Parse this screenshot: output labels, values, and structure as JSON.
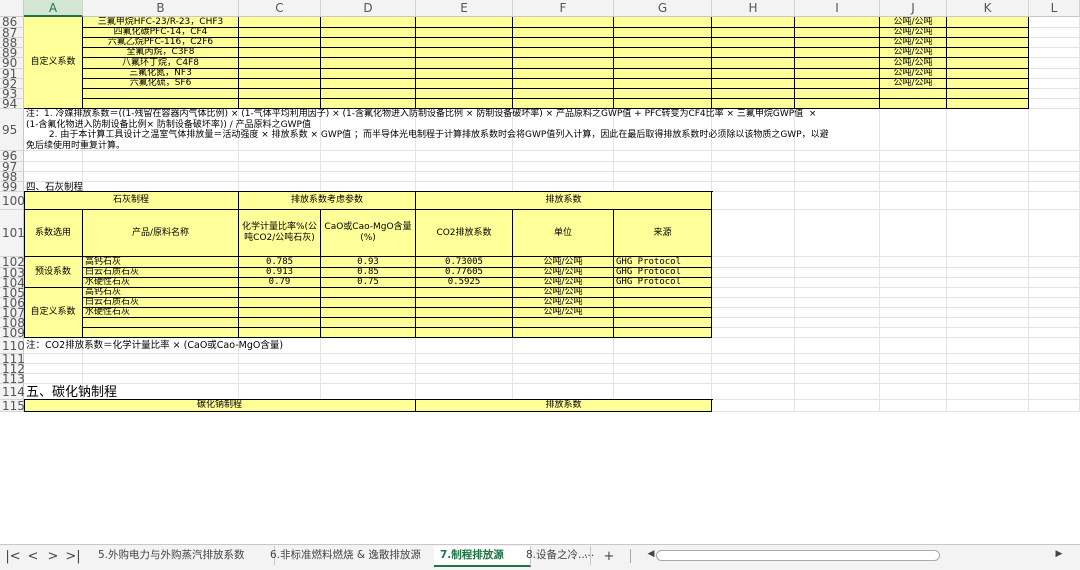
{
  "columns": [
    "A",
    "B",
    "C",
    "D",
    "E",
    "F",
    "G",
    "H",
    "I",
    "J",
    "K",
    "L"
  ],
  "selected_column": "A",
  "rows": [
    "86",
    "87",
    "88",
    "89",
    "90",
    "91",
    "92",
    "93",
    "94",
    "95",
    "96",
    "97",
    "98",
    "99",
    "100",
    "101",
    "102",
    "103",
    "104",
    "105",
    "106",
    "107",
    "108",
    "109",
    "110",
    "111",
    "112",
    "113",
    "114",
    "115"
  ],
  "block1": {
    "label": "自定义系数",
    "gases": [
      "三氟甲烷HFC-23/R-23，CHF3",
      "四氟化碳PFC-14，CF4",
      "六氟乙烷PFC-116，C2F6",
      "全氟丙烷，C3F8",
      "八氟环丁烷，C4F8",
      "三氟化氮，NF3",
      "六氟化硫，SF6"
    ],
    "unit": "公吨/公吨"
  },
  "note95": {
    "line1": "注：1. 冷媒排放系数＝((1-残留在容器内气体比例) × (1-气体平均利用因子) × (1-含氟化物进入防制设备比例 × 防制设备破坏率) × 产品原料之GWP值 + PFC转变为CF4比率 × 三氟甲烷GWP值  ×",
    "line2": "(1-含氟化物进入防制设备比例× 防制设备破坏率)) / 产品原料之GWP值",
    "line3": "        2. 由于本计算工具设计之温室气体排放量＝活动强度 × 排放系数 × GWP值 ；而半导体光电制程于计算排放系数时会将GWP值列入计算，因此在最后取得排放系数时必须除以该物质之GWP，以避",
    "line4": "免后续使用时重复计算。"
  },
  "section4": {
    "heading": "四、石灰制程",
    "hdr_lime": "石灰制程",
    "hdr_params": "排放系数考虑参数",
    "hdr_factor": "排放系数",
    "col_select": "系数选用",
    "col_name": "产品/原料名称",
    "col_ratio": "化学计量比率%(公吨CO2/公吨石灰)",
    "col_cao": "CaO或Cao-MgO含量(%)",
    "col_co2": "CO2排放系数",
    "col_unit": "单位",
    "col_source": "来源",
    "preset_label": "预设系数",
    "custom_label": "自定义系数",
    "preset_rows": [
      {
        "name": "高钙石灰",
        "ratio": "0.785",
        "cao": "0.93",
        "co2": "0.73005",
        "unit": "公吨/公吨",
        "source": "GHG Protocol"
      },
      {
        "name": "白云石质石灰",
        "ratio": "0.913",
        "cao": "0.85",
        "co2": "0.77605",
        "unit": "公吨/公吨",
        "source": "GHG Protocol"
      },
      {
        "name": "水硬性石灰",
        "ratio": "0.79",
        "cao": "0.75",
        "co2": "0.5925",
        "unit": "公吨/公吨",
        "source": "GHG Protocol"
      }
    ],
    "custom_rows": [
      {
        "name": "高钙石灰",
        "unit": "公吨/公吨"
      },
      {
        "name": "白云石质石灰",
        "unit": "公吨/公吨"
      },
      {
        "name": "水硬性石灰",
        "unit": "公吨/公吨"
      }
    ],
    "note": "注：CO2排放系数＝化学计量比率 × (CaO或Cao-MgO含量)"
  },
  "section5": {
    "heading": "五、碳化钠制程",
    "hdr_left": "碳化钠制程",
    "hdr_right": "排放系数"
  },
  "tabs": {
    "items": [
      "5.外购电力与外购蒸汽排放系数",
      "6.非标准燃料燃烧 & 逸散排放源",
      "7.制程排放源",
      "8.设备之冷..."
    ],
    "active_index": 2,
    "more": "···",
    "add": "+"
  }
}
